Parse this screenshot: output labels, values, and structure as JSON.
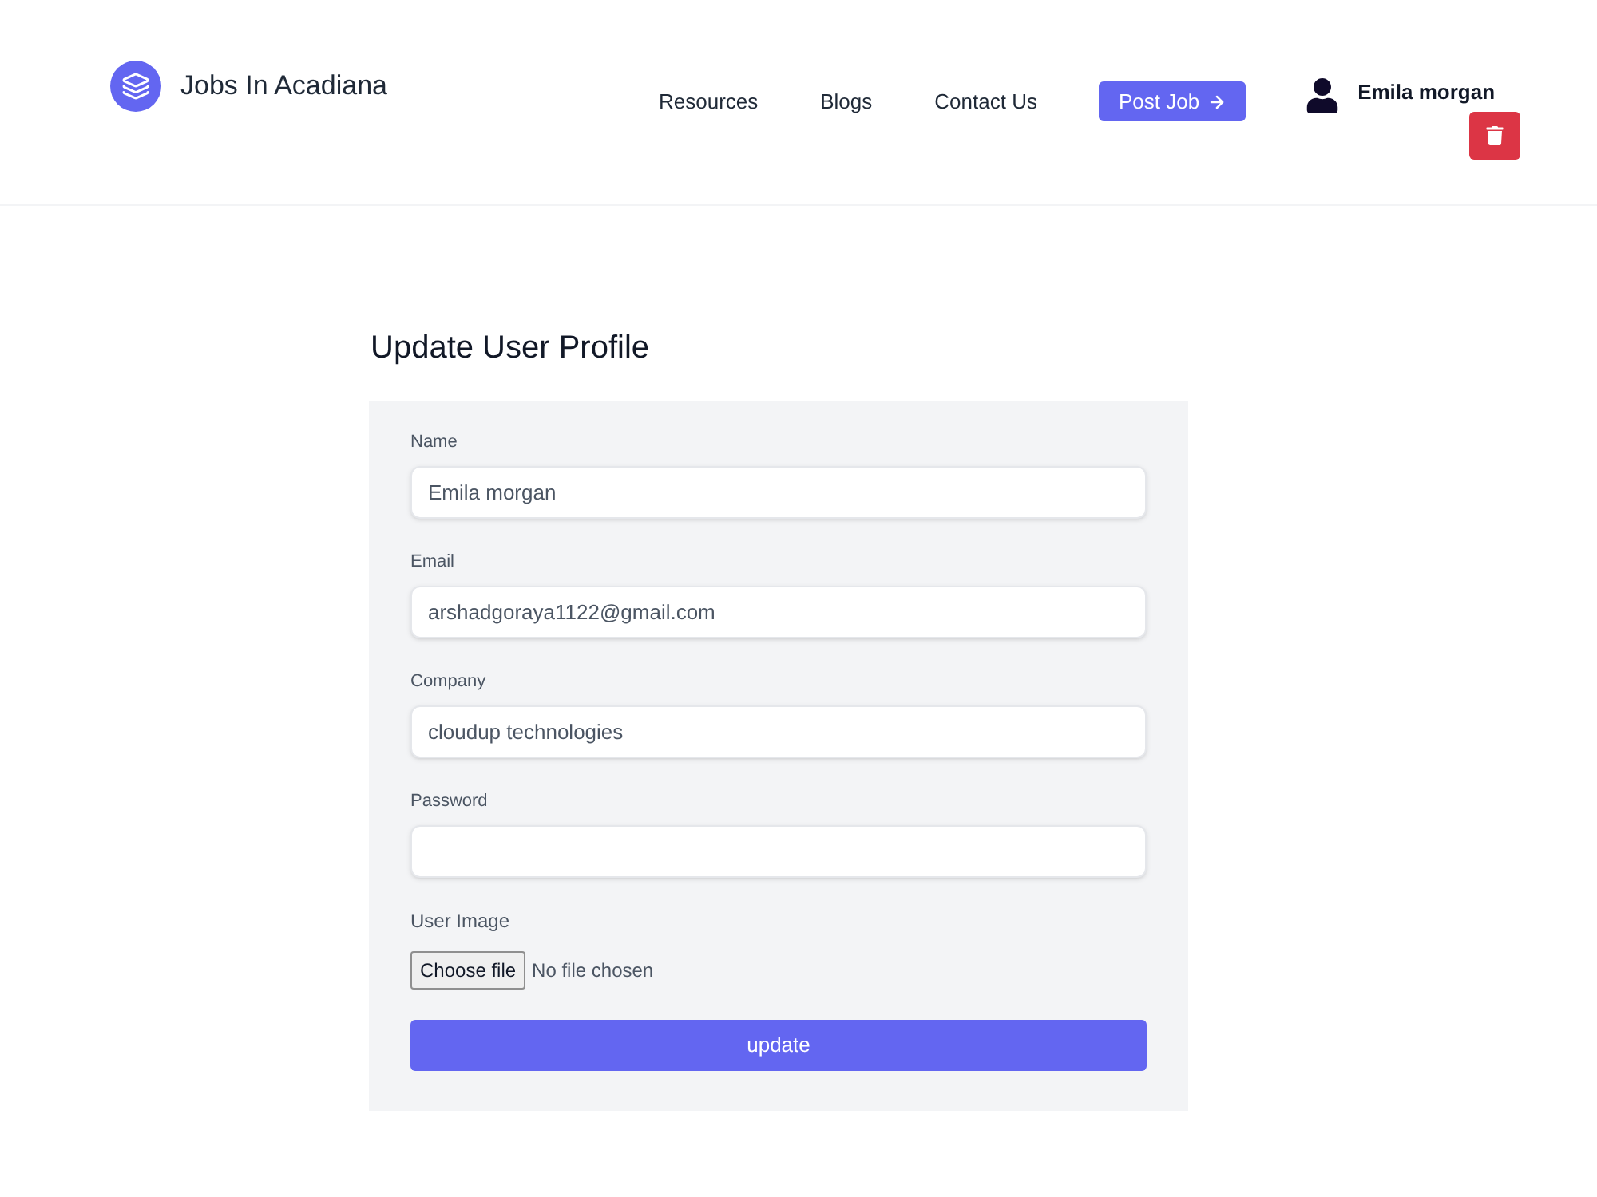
{
  "header": {
    "logo_text": "Jobs In Acadiana",
    "nav_links": [
      "Resources",
      "Blogs",
      "Contact Us"
    ],
    "post_job_button": "Post Job",
    "user_name": "Emila morgan"
  },
  "form": {
    "title": "Update User Profile",
    "fields": [
      {
        "kind": "text",
        "label": "Name",
        "value": "Emila morgan"
      },
      {
        "kind": "text",
        "label": "Email",
        "value": "arshadgoraya1122@gmail.com"
      },
      {
        "kind": "text",
        "label": "Company",
        "value": "cloudup technologies"
      },
      {
        "kind": "password",
        "label": "Password"
      },
      {
        "kind": "file",
        "label": "User Image",
        "button": "Choose file",
        "status": "No file chosen"
      }
    ],
    "submit_button": "update"
  }
}
